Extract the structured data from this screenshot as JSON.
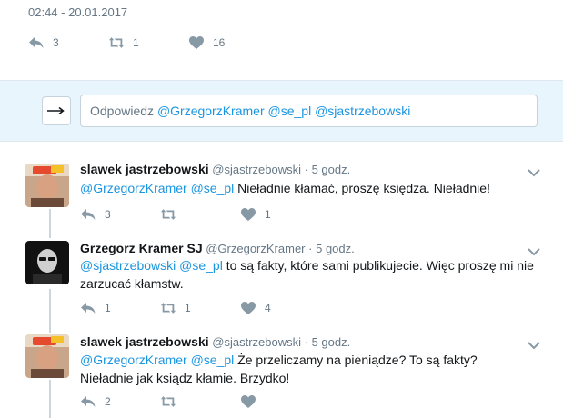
{
  "main_tweet": {
    "timestamp": "02:44 - 20.01.2017",
    "replies": "3",
    "retweets": "1",
    "likes": "16"
  },
  "reply_box": {
    "prefix": "Odpowiedz",
    "mentions": "@GrzegorzKramer @se_pl @sjastrzebowski"
  },
  "tweets": [
    {
      "name": "slawek jastrzebowski",
      "handle": "@sjastrzebowski",
      "sep": "·",
      "time": "5 godz.",
      "mentions": "@GrzegorzKramer @se_pl",
      "text_line1": " Nieładnie kłamać, proszę księdza. Nieładnie!",
      "text_line2": "",
      "replies": "3",
      "retweets": "",
      "likes": "1"
    },
    {
      "name": "Grzegorz Kramer SJ",
      "handle": "@GrzegorzKramer",
      "sep": "·",
      "time": "5 godz.",
      "mentions": "@sjastrzebowski @se_pl",
      "text_line1": " to są fakty, które sami publikujecie. Więc proszę mi nie",
      "text_line2": "zarzucać kłamstw.",
      "replies": "1",
      "retweets": "1",
      "likes": "4"
    },
    {
      "name": "slawek jastrzebowski",
      "handle": "@sjastrzebowski",
      "sep": "·",
      "time": "5 godz.",
      "mentions": "@GrzegorzKramer @se_pl",
      "text_line1": " Że przeliczamy na pieniądze? To są fakty?",
      "text_line2": "Nieładnie jak ksiądz kłamie. Brzydko!",
      "replies": "2",
      "retweets": "",
      "likes": ""
    }
  ],
  "colors": {
    "link": "#1b95e0",
    "muted": "#657786",
    "icon": "#8899a6",
    "reply_bar_bg": "#e8f5fd"
  }
}
